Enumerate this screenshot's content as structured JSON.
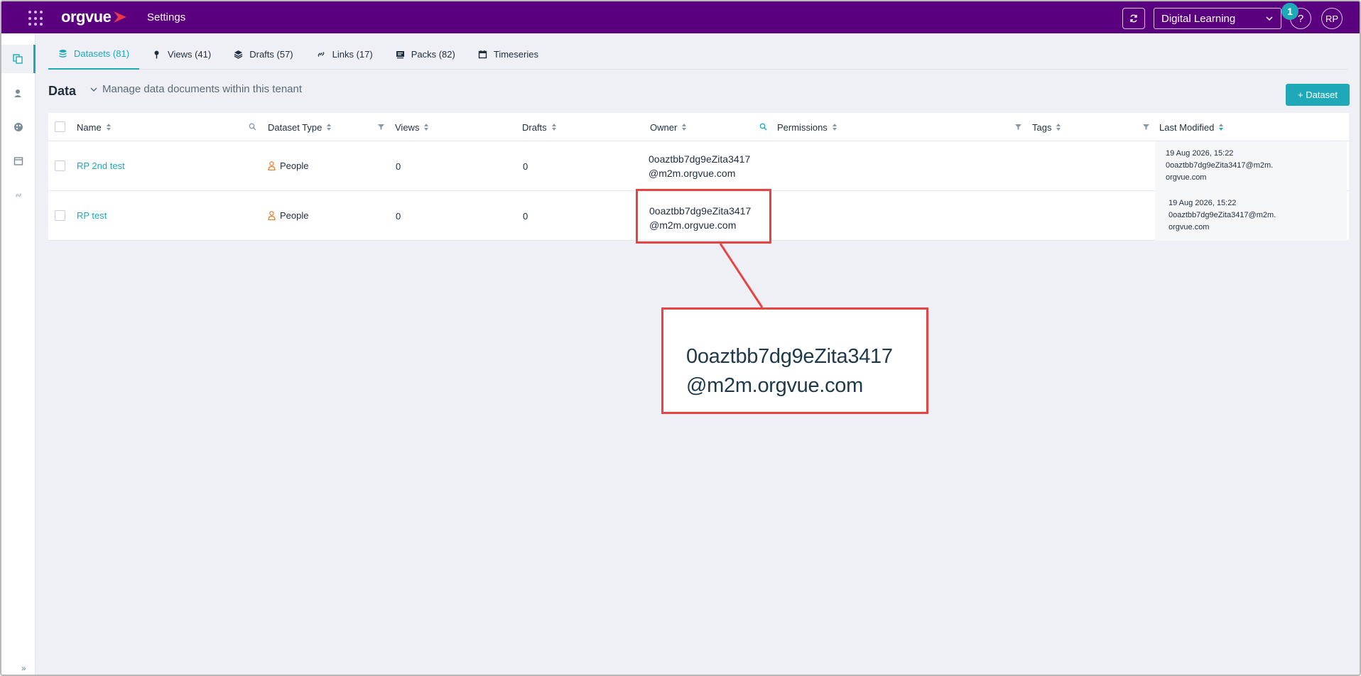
{
  "topbar": {
    "logo_text": "orgvue",
    "app_title": "Settings",
    "tenant": "Digital Learning",
    "help_label": "?",
    "notification_count": "1",
    "avatar_initials": "RP",
    "brand_color": "#5a007f"
  },
  "rail": {
    "items": [
      "datasets-icon",
      "users-icon",
      "palette-icon",
      "window-icon",
      "link-icon"
    ],
    "expand_label": "»"
  },
  "tabs": [
    {
      "label": "Datasets (81)",
      "icon": "database-icon",
      "active": true
    },
    {
      "label": "Views (41)",
      "icon": "pin-icon"
    },
    {
      "label": "Drafts (57)",
      "icon": "layers-icon"
    },
    {
      "label": "Links (17)",
      "icon": "link-icon"
    },
    {
      "label": "Packs (82)",
      "icon": "pack-icon"
    },
    {
      "label": "Timeseries",
      "icon": "calendar-icon"
    }
  ],
  "page": {
    "title": "Data",
    "subtitle": "Manage data documents within this tenant",
    "add_button": "+ Dataset"
  },
  "table": {
    "columns": [
      "Name",
      "Dataset Type",
      "Views",
      "Drafts",
      "Owner",
      "Permissions",
      "Tags",
      "Last Modified"
    ],
    "rows": [
      {
        "name": "RP 2nd test",
        "type": "People",
        "views": "0",
        "drafts": "0",
        "owner_line1": "0oaztbb7dg9eZita3417",
        "owner_line2": "@m2m.orgvue.com",
        "modified_date": "19 Aug 2026, 15:22",
        "modified_by_line1": "0oaztbb7dg9eZita3417@m2m.",
        "modified_by_line2": "orgvue.com"
      },
      {
        "name": "RP test",
        "type": "People",
        "views": "0",
        "drafts": "0",
        "owner_line1": "0oaztbb7dg9eZita3417",
        "owner_line2": "@m2m.orgvue.com",
        "modified_date": "19 Aug 2026, 15:22",
        "modified_by_line1": "0oaztbb7dg9eZita3417@m2m.",
        "modified_by_line2": "orgvue.com"
      }
    ]
  },
  "zoom": {
    "line1": "0oaztbb7dg9eZita3417",
    "line2": "@m2m.orgvue.com"
  },
  "colors": {
    "accent": "#1fa9b8",
    "highlight": "#e84343",
    "person_icon": "#e07b2e"
  }
}
